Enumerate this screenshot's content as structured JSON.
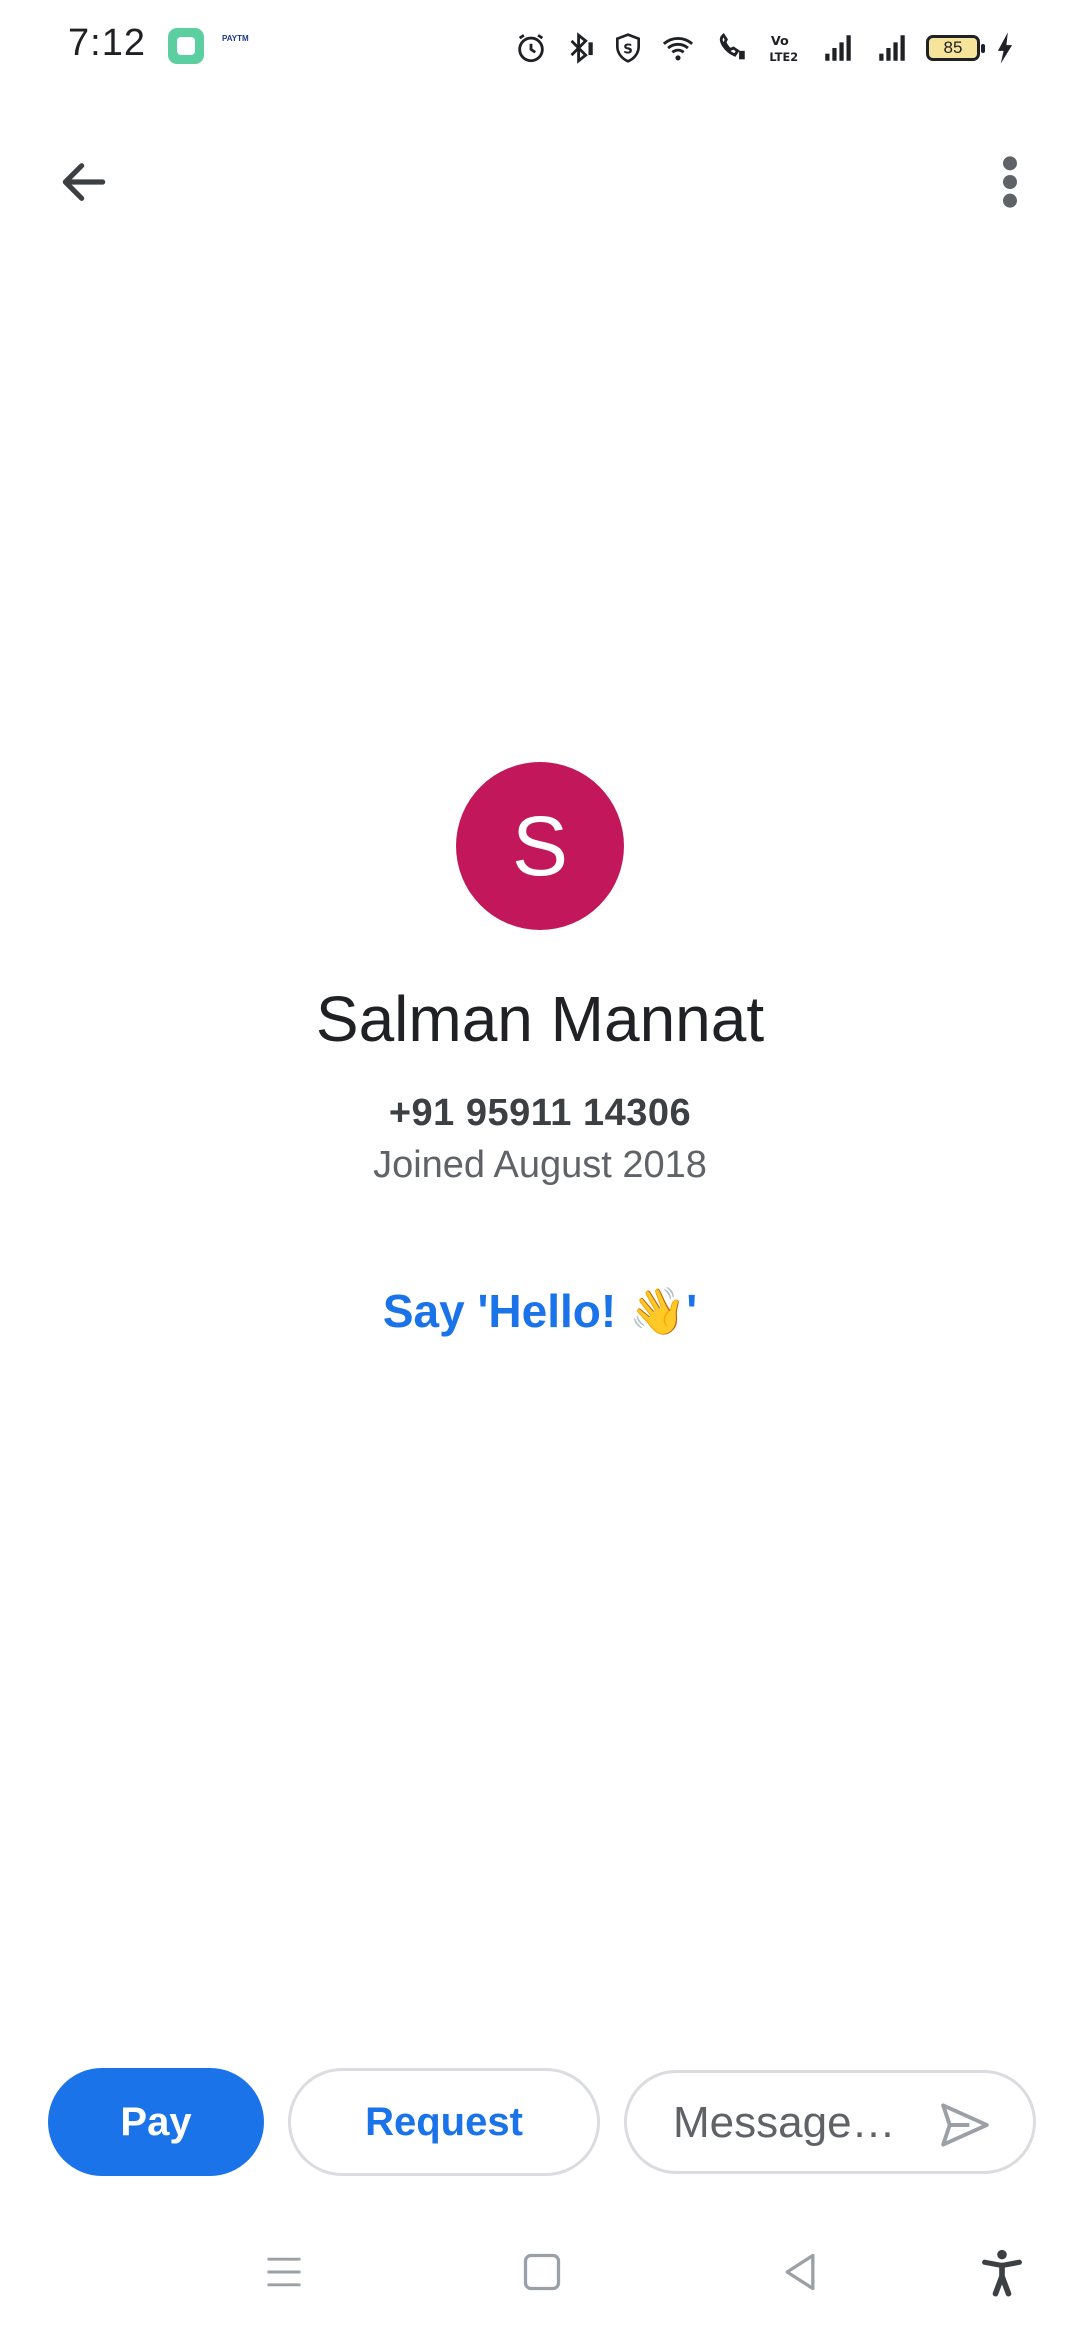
{
  "status_bar": {
    "time": "7:12",
    "battery_level": "85",
    "app_icon_2_text": "PAYTM"
  },
  "icons": {
    "back": "arrow-back-icon",
    "more": "more-vert-icon",
    "send": "send-icon",
    "alarm": "alarm-icon",
    "bluetooth": "bluetooth-icon",
    "shield": "shield-icon",
    "wifi": "wifi-icon",
    "wifi_calling": "wifi-calling-icon",
    "volte": "volte-icon",
    "signal": "signal-icon",
    "charging": "charging-bolt-icon"
  },
  "profile": {
    "avatar_initial": "S",
    "avatar_color": "#c2185b",
    "name": "Salman Mannat",
    "phone": "+91 95911 14306",
    "joined": "Joined August 2018",
    "say_hello": "Say 'Hello! 👋'"
  },
  "actions": {
    "pay_label": "Pay",
    "request_label": "Request",
    "message_placeholder": "Message…"
  },
  "colors": {
    "accent": "#1a73e8",
    "avatar": "#c2185b",
    "border": "#dadce0"
  }
}
